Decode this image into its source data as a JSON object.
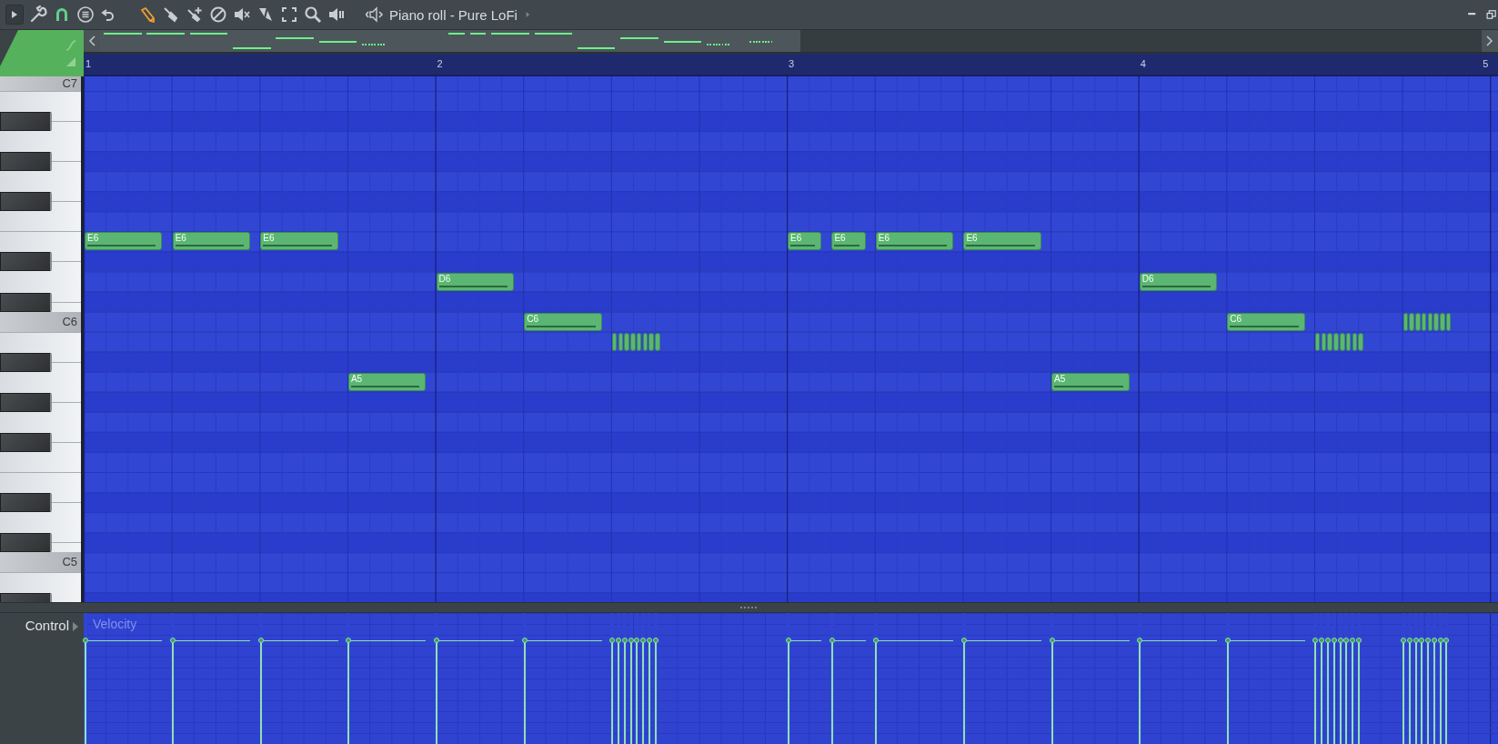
{
  "toolbar": {
    "title": "Piano roll - Pure LoFi"
  },
  "ruler": {
    "bars": [
      "1",
      "2",
      "3",
      "4",
      "5"
    ]
  },
  "keyboard": {
    "rows": [
      {
        "kind": "white",
        "label": "C7",
        "notes": []
      },
      {
        "kind": "white",
        "notes": []
      },
      {
        "kind": "black",
        "notes": []
      },
      {
        "kind": "white",
        "notes": []
      },
      {
        "kind": "black",
        "notes": []
      },
      {
        "kind": "white",
        "notes": []
      },
      {
        "kind": "black",
        "notes": []
      },
      {
        "kind": "white",
        "notes": []
      },
      {
        "kind": "white",
        "notes": [
          {
            "label": "E6",
            "level": 0.79
          },
          {
            "label": "E6",
            "level": 0.79
          },
          {
            "label": "E6",
            "level": 0.79
          },
          {
            "label": "E6",
            "level": 0.79
          },
          {
            "label": "E6",
            "level": 0.79
          },
          {
            "label": "E6",
            "level": 0.79
          },
          {
            "label": "E6",
            "level": 0.79
          }
        ]
      },
      {
        "kind": "black",
        "notes": []
      },
      {
        "kind": "white",
        "notes": [
          {
            "label": "D6",
            "level": 0.79
          },
          {
            "label": "D6",
            "level": 0.79
          }
        ]
      },
      {
        "kind": "black",
        "notes": []
      },
      {
        "kind": "white",
        "label": "C6",
        "notes": [
          {
            "label": "C6",
            "level": 0.79
          },
          {
            "label": "C6",
            "level": 0.79
          },
          {
            "level": 0.79
          },
          {
            "level": 0.79
          },
          {
            "level": 0.79
          },
          {
            "level": 0.79
          },
          {
            "level": 0.79
          },
          {
            "level": 0.79
          },
          {
            "level": 0.79
          },
          {
            "level": 0.79
          }
        ]
      },
      {
        "kind": "white",
        "notes": [
          {
            "level": 0.79
          },
          {
            "level": 0.79
          },
          {
            "level": 0.79
          },
          {
            "level": 0.79
          },
          {
            "level": 0.79
          },
          {
            "level": 0.79
          },
          {
            "level": 0.79
          },
          {
            "level": 0.79
          },
          {
            "level": 0.79
          },
          {
            "level": 0.79
          },
          {
            "level": 0.79
          },
          {
            "level": 0.79
          },
          {
            "level": 0.79
          },
          {
            "level": 0.79
          },
          {
            "level": 0.79
          },
          {
            "level": 0.79
          }
        ]
      },
      {
        "kind": "black",
        "notes": []
      },
      {
        "kind": "white",
        "notes": [
          {
            "label": "A5",
            "level": 0.79
          },
          {
            "label": "A5",
            "level": 0.79
          }
        ]
      },
      {
        "kind": "black",
        "notes": []
      },
      {
        "kind": "white",
        "notes": []
      },
      {
        "kind": "black",
        "notes": []
      },
      {
        "kind": "white",
        "notes": []
      },
      {
        "kind": "white",
        "notes": []
      },
      {
        "kind": "black",
        "notes": []
      },
      {
        "kind": "white",
        "notes": []
      },
      {
        "kind": "black",
        "notes": []
      },
      {
        "kind": "white",
        "label": "C5",
        "notes": []
      },
      {
        "kind": "white",
        "notes": []
      },
      {
        "kind": "black",
        "notes": []
      }
    ]
  },
  "control": {
    "label": "Control",
    "lane": "Velocity"
  }
}
